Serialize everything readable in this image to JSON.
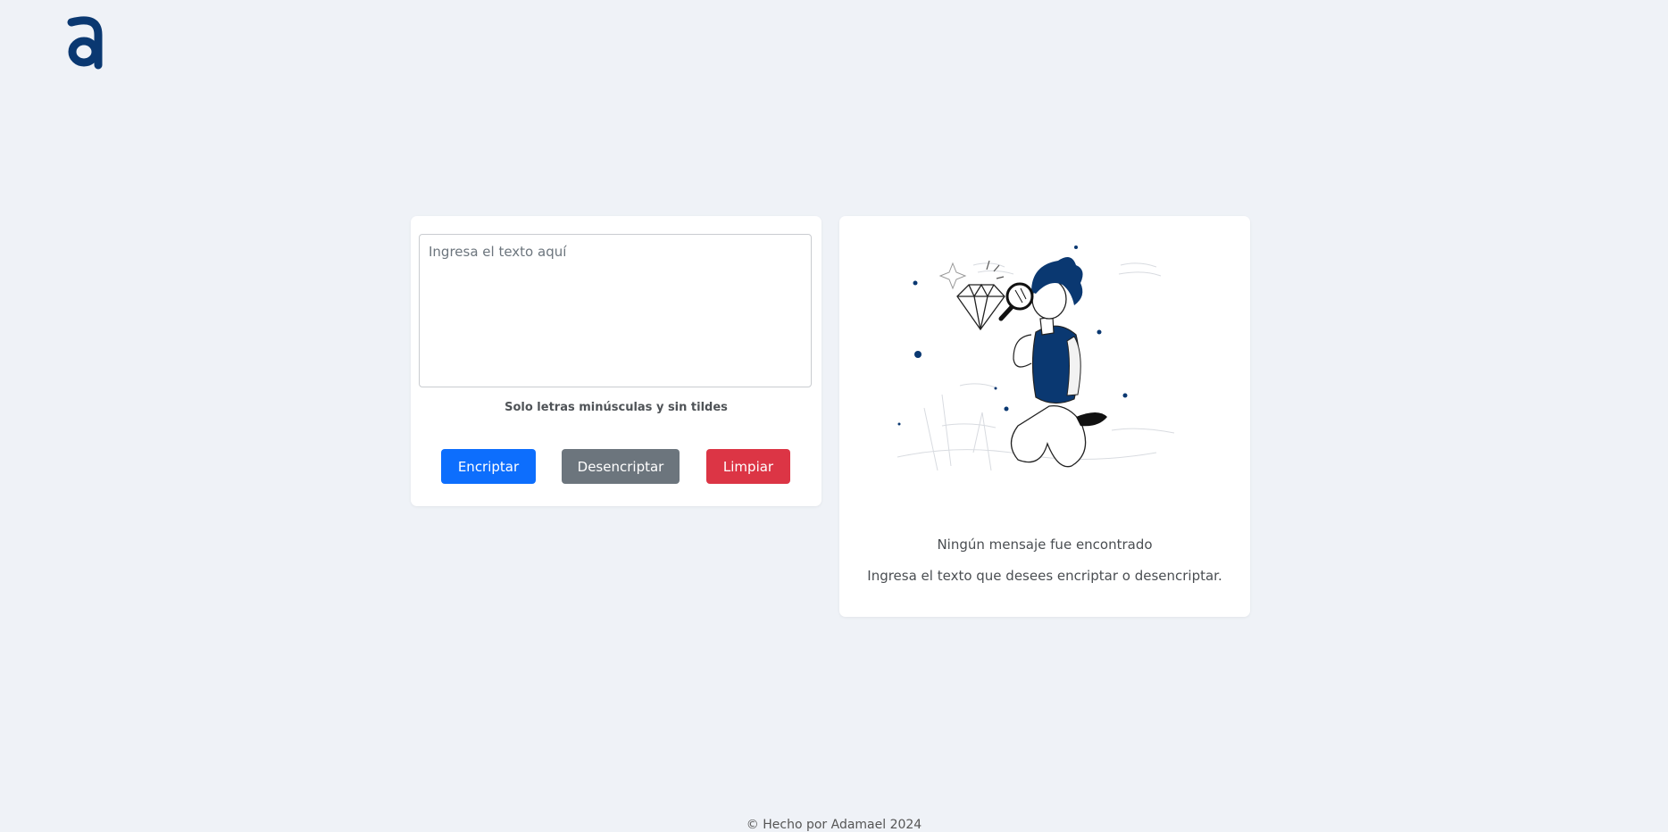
{
  "brand": {
    "logo_letter": "a",
    "color": "#0a3871"
  },
  "input": {
    "placeholder": "Ingresa el texto aquí",
    "value": ""
  },
  "hint": "Solo letras minúsculas y sin tildes",
  "buttons": {
    "encrypt": "Encriptar",
    "decrypt": "Desencriptar",
    "clear": "Limpiar"
  },
  "output": {
    "title": "Ningún mensaje fue encontrado",
    "subtitle": "Ingresa el texto que desees encriptar o desencriptar."
  },
  "footer": "© Hecho por Adamael 2024",
  "colors": {
    "background": "#eff2f7",
    "primary": "#0d6efd",
    "secondary": "#6c757d",
    "danger": "#dc3545",
    "accent": "#0a3871"
  }
}
